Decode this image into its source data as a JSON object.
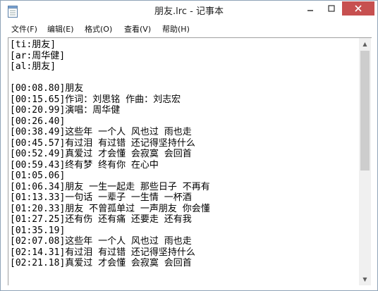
{
  "window": {
    "title": "朋友.lrc - 记事本"
  },
  "menu": {
    "items": [
      "文件(F)",
      "编辑(E)",
      "格式(O)",
      "查看(V)",
      "帮助(H)"
    ]
  },
  "editor": {
    "lines": [
      "[ti:朋友]",
      "[ar:周华健]",
      "[al:朋友]",
      "",
      "[00:08.80]朋友",
      "[00:15.65]作词：刘思铭 作曲：刘志宏",
      "[00:20.99]演唱：周华健",
      "[00:26.40]",
      "[00:38.49]这些年 一个人 风也过 雨也走",
      "[00:45.57]有过泪 有过错 还记得坚持什么",
      "[00:52.49]真爱过 才会懂 会寂寞 会回首",
      "[00:59.43]终有梦 终有你 在心中",
      "[01:05.06]",
      "[01:06.34]朋友 一生一起走 那些日子 不再有",
      "[01:13.33]一句话 一辈子 一生情 一杯酒",
      "[01:20.33]朋友 不曾孤单过 一声朋友 你会懂",
      "[01:27.25]还有伤 还有痛 还要走 还有我",
      "[01:35.19]",
      "[02:07.08]这些年 一个人 风也过 雨也走",
      "[02:14.31]有过泪 有过错 还记得坚持什么",
      "[02:21.18]真爱过 才会懂 会寂寞 会回首"
    ]
  }
}
